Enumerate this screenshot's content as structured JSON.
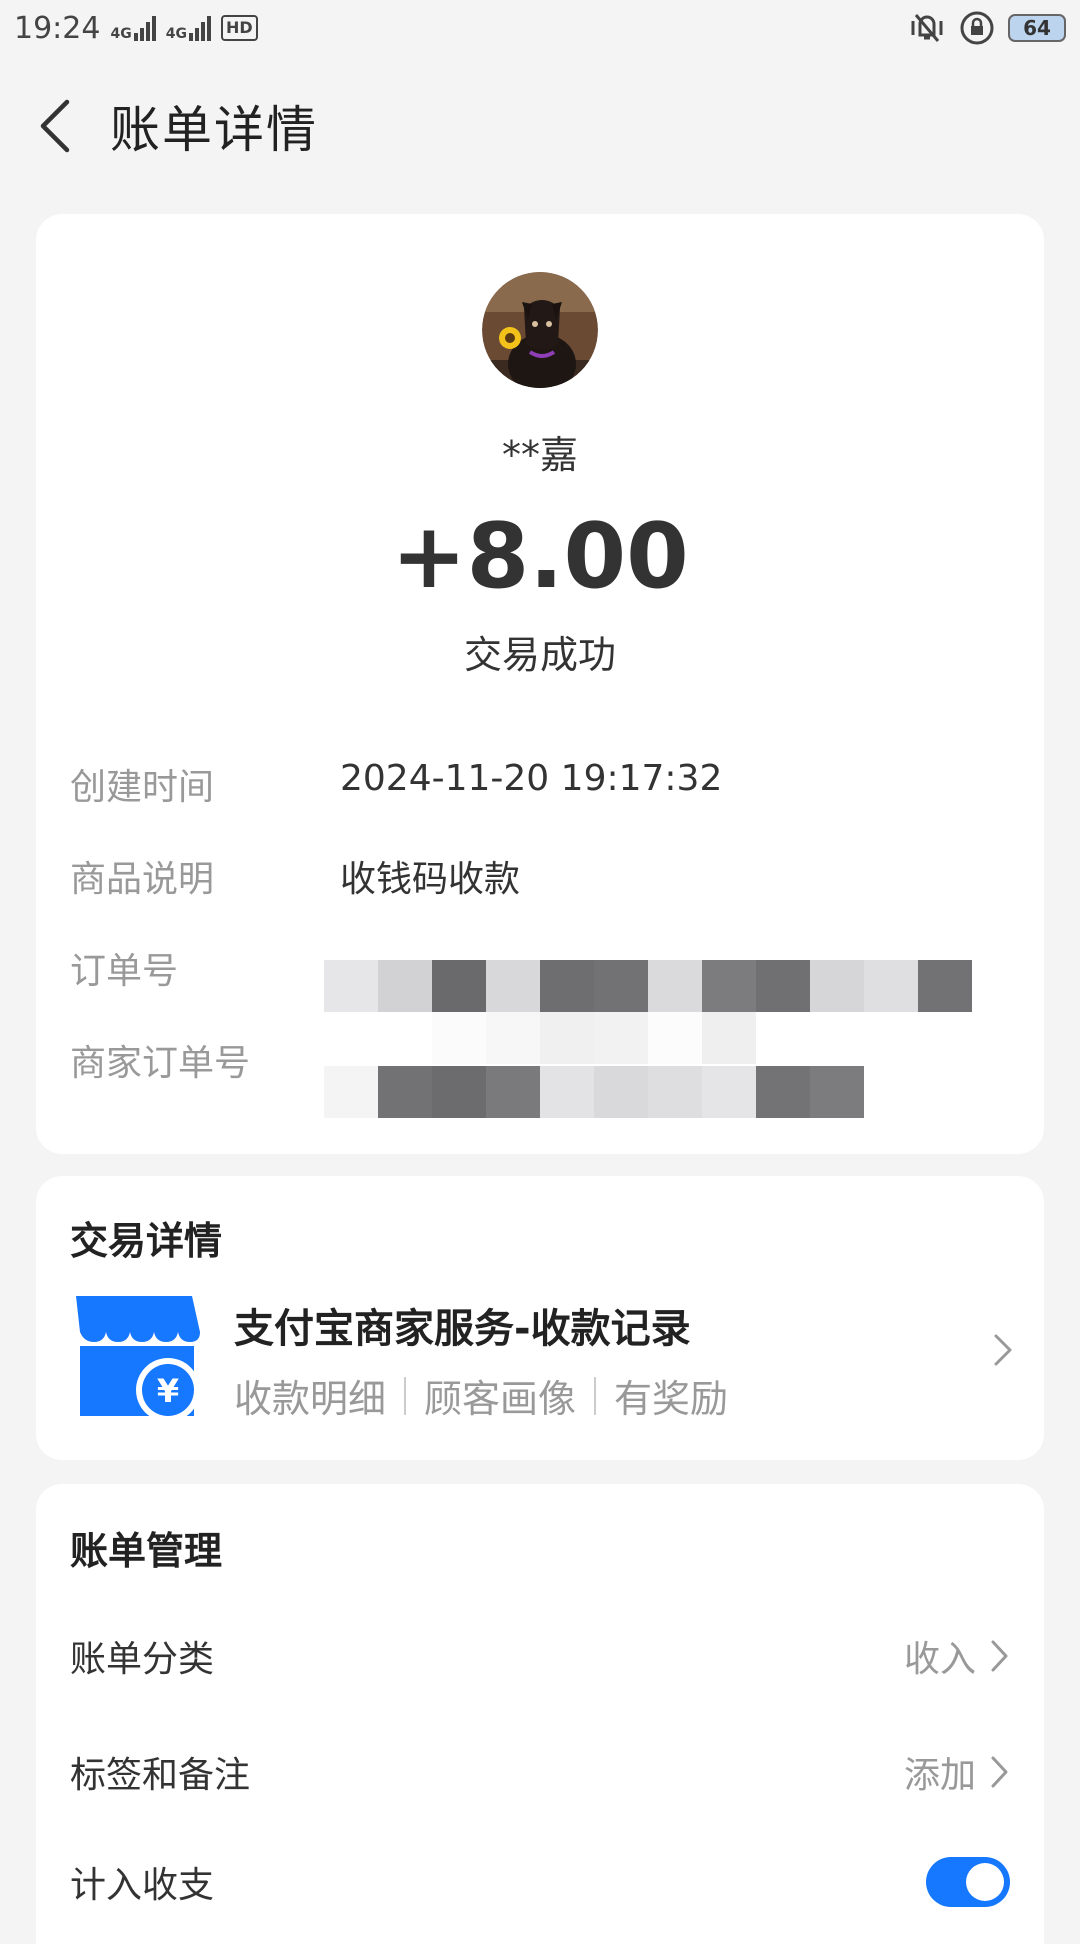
{
  "status_bar": {
    "time": "19:24",
    "signal1": "4G",
    "signal2": "4G",
    "hd": "HD",
    "battery": "64"
  },
  "header": {
    "title": "账单详情"
  },
  "summary": {
    "payer_name": "**嘉",
    "amount": "+8.00",
    "status": "交易成功"
  },
  "details": {
    "created_label": "创建时间",
    "created_value": "2024-11-20 19:17:32",
    "goods_label": "商品说明",
    "goods_value": "收钱码收款",
    "order_label": "订单号",
    "merchant_order_label": "商家订单号"
  },
  "trade": {
    "section_title": "交易详情",
    "service_title": "支付宝商家服务-收款记录",
    "links": [
      "收款明细",
      "顾客画像",
      "有奖励"
    ]
  },
  "management": {
    "section_title": "账单管理",
    "category_label": "账单分类",
    "category_value": "收入",
    "tags_label": "标签和备注",
    "tags_value": "添加",
    "include_label": "计入收支",
    "include_enabled": true
  },
  "colors": {
    "accent": "#1677ff",
    "background": "#f4f4f4",
    "muted_text": "#999999"
  }
}
